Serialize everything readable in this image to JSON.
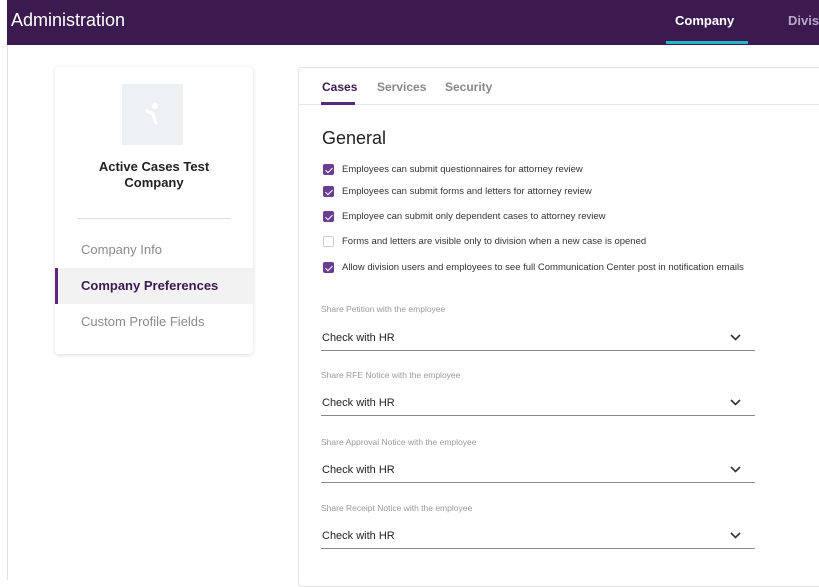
{
  "header": {
    "title": "Administration",
    "nav": [
      "Company",
      "Divisi"
    ],
    "colors": {
      "bar": "#3b1a4f",
      "active_underline": "#26b7c4"
    }
  },
  "sidebar": {
    "logo_icon": "person-figure-icon",
    "company_name": "Active Cases Test Company",
    "items": [
      {
        "label": "Company Info",
        "active": false
      },
      {
        "label": "Company Preferences",
        "active": true
      },
      {
        "label": "Custom Profile Fields",
        "active": false
      }
    ]
  },
  "main": {
    "tabs": [
      {
        "label": "Cases",
        "active": true
      },
      {
        "label": "Services",
        "active": false
      },
      {
        "label": "Security",
        "active": false
      }
    ],
    "section_title": "General",
    "checkboxes": [
      {
        "label": "Employees can submit questionnaires for attorney review",
        "checked": true
      },
      {
        "label": "Employees can submit forms and letters for attorney review",
        "checked": true
      },
      {
        "label": "Employee can submit only dependent cases to attorney review",
        "checked": true
      },
      {
        "label": "Forms and letters are visible only to division when a new case is opened",
        "checked": false
      },
      {
        "label": "Allow division users and employees to see full Communication Center post in notification emails",
        "checked": true
      }
    ],
    "selects": [
      {
        "label": "Share Petition with the employee",
        "value": "Check with HR"
      },
      {
        "label": "Share RFE Notice with the employee",
        "value": "Check with HR"
      },
      {
        "label": "Share Approval Notice with the employee",
        "value": "Check with HR"
      },
      {
        "label": "Share Receipt Notice with the employee",
        "value": "Check with HR"
      }
    ],
    "accent_color": "#6b3d92"
  }
}
